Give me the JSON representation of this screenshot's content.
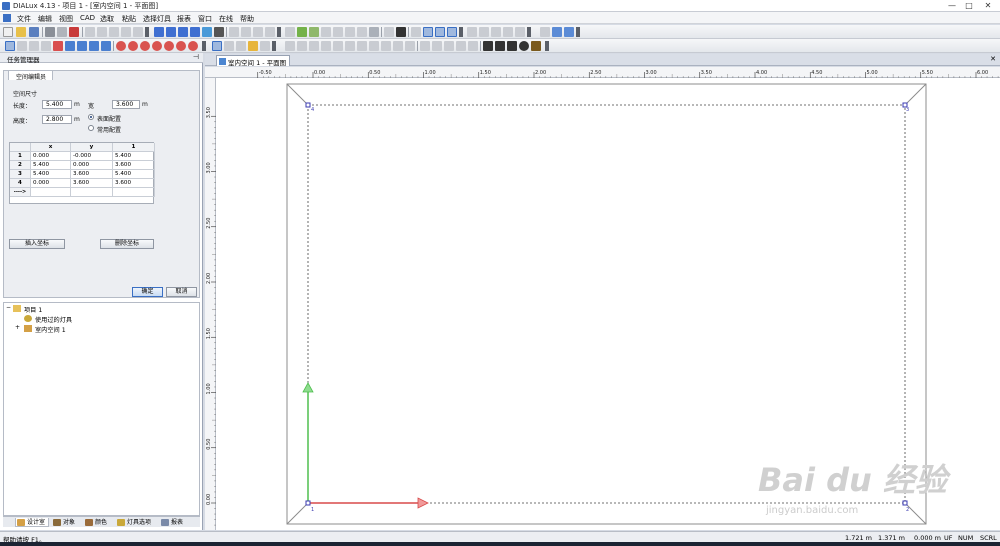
{
  "window": {
    "title": "DIALux 4.13 - 项目 1 - [室内空间 1 - 平面图]",
    "minimize": "—",
    "maximize": "□",
    "close": "✕"
  },
  "menu": [
    "文件",
    "编辑",
    "视图",
    "CAD",
    "选取",
    "粘贴",
    "选择灯具",
    "报表",
    "窗口",
    "在线",
    "帮助"
  ],
  "task_manager": {
    "title": "任务管理器",
    "pin": "⊣",
    "editor_tab": "空间编辑员",
    "section_title": "空间尺寸",
    "length_label": "长度：",
    "length_value": "5.400",
    "length_unit": "m",
    "width_label": "宽",
    "width_value": "3.600",
    "width_unit": "m",
    "height_label": "高度：",
    "height_value": "2.800",
    "height_unit": "m",
    "radio_surface": "表面配置",
    "radio_common": "常用配置",
    "grid_headers": [
      "x",
      "y",
      "1"
    ],
    "grid_rows": [
      {
        "num": "1",
        "x": "0.000",
        "y": "-0.000",
        "z": "5.400"
      },
      {
        "num": "2",
        "x": "5.400",
        "y": "0.000",
        "z": "3.600"
      },
      {
        "num": "3",
        "x": "5.400",
        "y": "3.600",
        "z": "5.400"
      },
      {
        "num": "4",
        "x": "0.000",
        "y": "3.600",
        "z": "3.600"
      }
    ],
    "grid_new_row": "---->",
    "insert_btn": "插入坐标",
    "delete_btn": "删除坐标",
    "ok_btn": "确定",
    "cancel_btn": "取消"
  },
  "tree": {
    "project": "项目 1",
    "used_luminaires": "使用过的灯具",
    "room": "室内空间 1",
    "expand_minus": "−",
    "expand_plus": "+"
  },
  "bottom_tabs": [
    "设计室",
    "对象",
    "颜色",
    "灯具选项",
    "报表"
  ],
  "document": {
    "tab_label": "室内空间 1 - 平面图",
    "hruler_labels": [
      "-0.50",
      "0.00",
      "0.50",
      "1.00",
      "1.50",
      "2.00",
      "2.50",
      "3.00",
      "3.50",
      "4.00",
      "4.50",
      "5.00",
      "5.50",
      "6.00"
    ],
    "vruler_labels": [
      "3.50",
      "3.00",
      "2.50",
      "2.00",
      "1.50",
      "1.00",
      "0.50",
      "0.00"
    ],
    "vertex_labels": [
      "4",
      "3",
      "1",
      "2"
    ]
  },
  "status": {
    "help": "帮助请按 F1。",
    "x": "1.721 m",
    "y": "1.371 m",
    "z": "0.000 m",
    "uf": "UF",
    "num": "NUM",
    "scrl": "SCRL"
  },
  "watermark": {
    "brand": "Bai du 经验",
    "url": "jingyan.baidu.com"
  },
  "colors": {
    "accent": "#3a6fc4",
    "x_axis": "#d84a4a",
    "y_axis": "#4fbf4f",
    "vertex": "#3a3ab0"
  }
}
